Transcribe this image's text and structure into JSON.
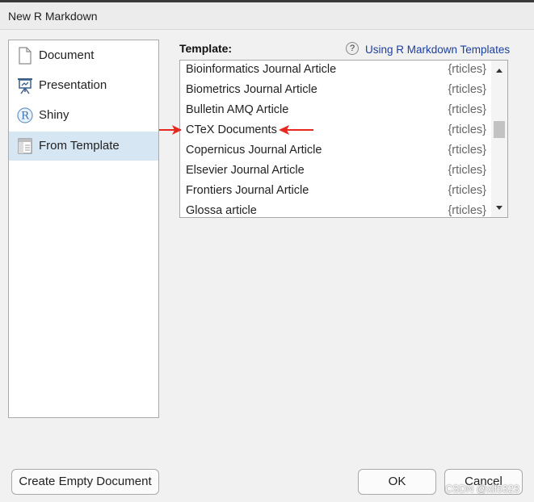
{
  "window": {
    "title": "New R Markdown"
  },
  "sidebar": {
    "items": [
      {
        "label": "Document",
        "icon": "document-icon",
        "selected": false
      },
      {
        "label": "Presentation",
        "icon": "presentation-icon",
        "selected": false
      },
      {
        "label": "Shiny",
        "icon": "shiny-r-icon",
        "selected": false
      },
      {
        "label": "From Template",
        "icon": "template-icon",
        "selected": true
      }
    ]
  },
  "template": {
    "label": "Template:",
    "help_link": "Using R Markdown Templates",
    "rows": [
      {
        "name": "Bioinformatics Journal Article",
        "package": "{rticles}"
      },
      {
        "name": "Biometrics Journal Article",
        "package": "{rticles}"
      },
      {
        "name": "Bulletin AMQ Article",
        "package": "{rticles}"
      },
      {
        "name": "CTeX Documents",
        "package": "{rticles}"
      },
      {
        "name": "Copernicus Journal Article",
        "package": "{rticles}"
      },
      {
        "name": "Elsevier Journal Article",
        "package": "{rticles}"
      },
      {
        "name": "Frontiers Journal Article",
        "package": "{rticles}"
      },
      {
        "name": "Glossa article",
        "package": "{rticles}"
      }
    ]
  },
  "buttons": {
    "create_empty": "Create Empty Document",
    "ok": "OK",
    "cancel": "Cancel"
  },
  "annotation": {
    "arrow_color": "#e8281e"
  },
  "watermark": "CSDN @xlf5323"
}
